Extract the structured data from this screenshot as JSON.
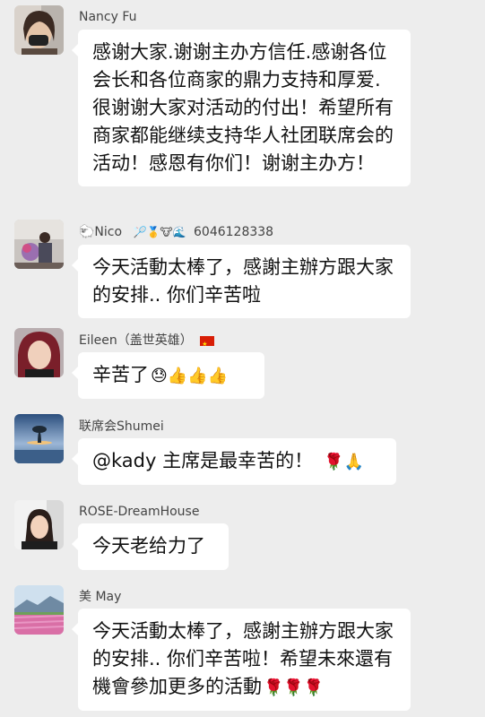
{
  "messages": [
    {
      "sender": "Nancy Fu",
      "text": "感谢大家.谢谢主办方信任.感谢各位会长和各位商家的鼎力支持和厚爱.很谢谢大家对活动的付出！希望所有商家都能继续支持华人社团联席会的活动！感恩有你们！谢谢主办方！"
    },
    {
      "sender": "🐑Nico",
      "sender_suffix": "🏸🥇🐮🌊",
      "sender_phone": "6046128338",
      "text": "今天活動太棒了，感謝主辦方跟大家的安排.. 你们辛苦啦"
    },
    {
      "sender": "Eileen（盖世英雄）",
      "text": "辛苦了",
      "emojis": "😓👍👍👍"
    },
    {
      "sender": "联席会Shumei",
      "text": "@kady  主席是最幸苦的！",
      "emojis": "🌹🙏"
    },
    {
      "sender": "ROSE-DreamHouse",
      "text": "今天老给力了"
    },
    {
      "sender": "美 May",
      "text": "今天活動太棒了，感謝主辦方跟大家的安排.. 你们辛苦啦！希望未來還有機會參加更多的活動",
      "emojis": "🌹🌹🌹"
    }
  ],
  "colors": {
    "background": "#ededed",
    "bubble": "#ffffff",
    "name_text": "#444444"
  }
}
